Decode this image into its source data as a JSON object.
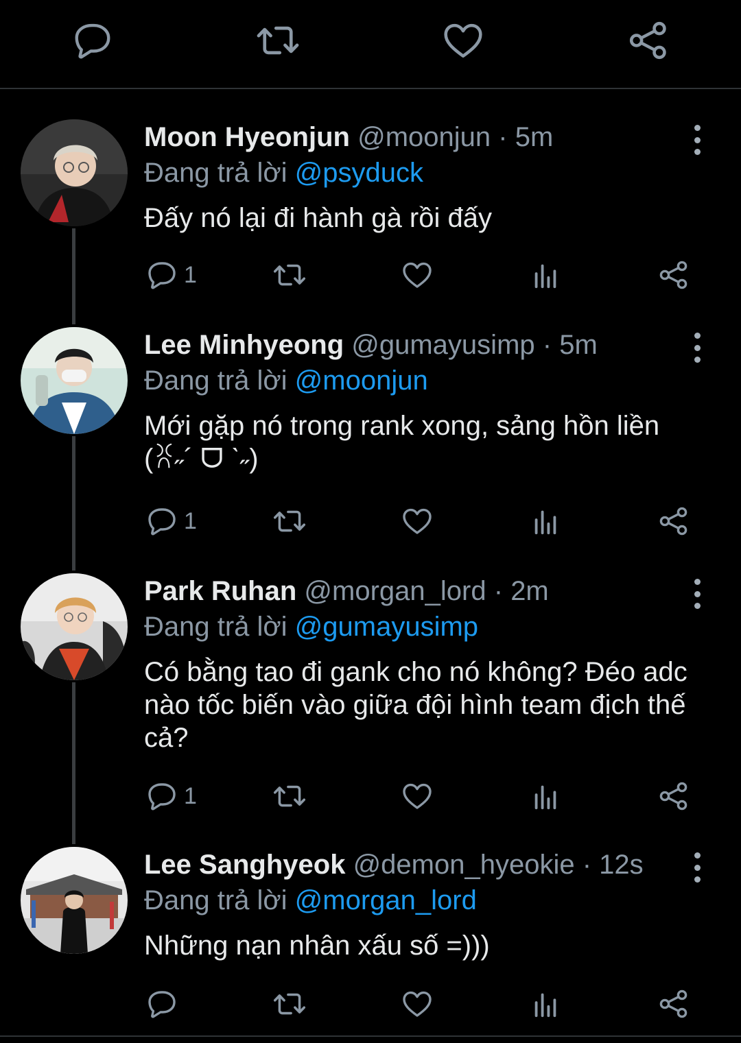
{
  "top_actions": {
    "icons": [
      "reply-icon",
      "retweet-icon",
      "like-icon",
      "share-icon"
    ]
  },
  "colors": {
    "background": "#000000",
    "text": "#e7e9ea",
    "muted": "#8b98a5",
    "mention": "#1d9bf0",
    "divider": "#2f3336"
  },
  "tweets": [
    {
      "name": "Moon Hyeonjun",
      "handle": "@moonjun",
      "separator": "·",
      "time": "5m",
      "reply_prefix": "Đang trả lời",
      "reply_to": "@psyduck",
      "text": "Đấy nó lại đi hành gà rồi đấy",
      "reply_count": "1"
    },
    {
      "name": "Lee Minhyeong",
      "handle": "@gumayusimp",
      "separator": "·",
      "time": "5m",
      "reply_prefix": "Đang trả lời",
      "reply_to": "@moonjun",
      "text": "Mới gặp nó trong rank xong, sảng hồn liền (ꐦ˶´ ᗜ ˋ˶)",
      "reply_count": "1"
    },
    {
      "name": "Park Ruhan",
      "handle": "@morgan_lord",
      "separator": "·",
      "time": "2m",
      "reply_prefix": "Đang trả lời",
      "reply_to": "@gumayusimp",
      "text": "Có bằng tao đi gank cho nó không? Đéo adc nào tốc biến vào giữa đội hình team địch thế cả?",
      "reply_count": "1"
    },
    {
      "name": "Lee Sanghyeok",
      "handle": "@demon_hyeokie",
      "separator": "·",
      "time": "12s",
      "reply_prefix": "Đang trả lời",
      "reply_to": "@morgan_lord",
      "text": "Những nạn nhân xấu số =)))",
      "reply_count": ""
    }
  ]
}
